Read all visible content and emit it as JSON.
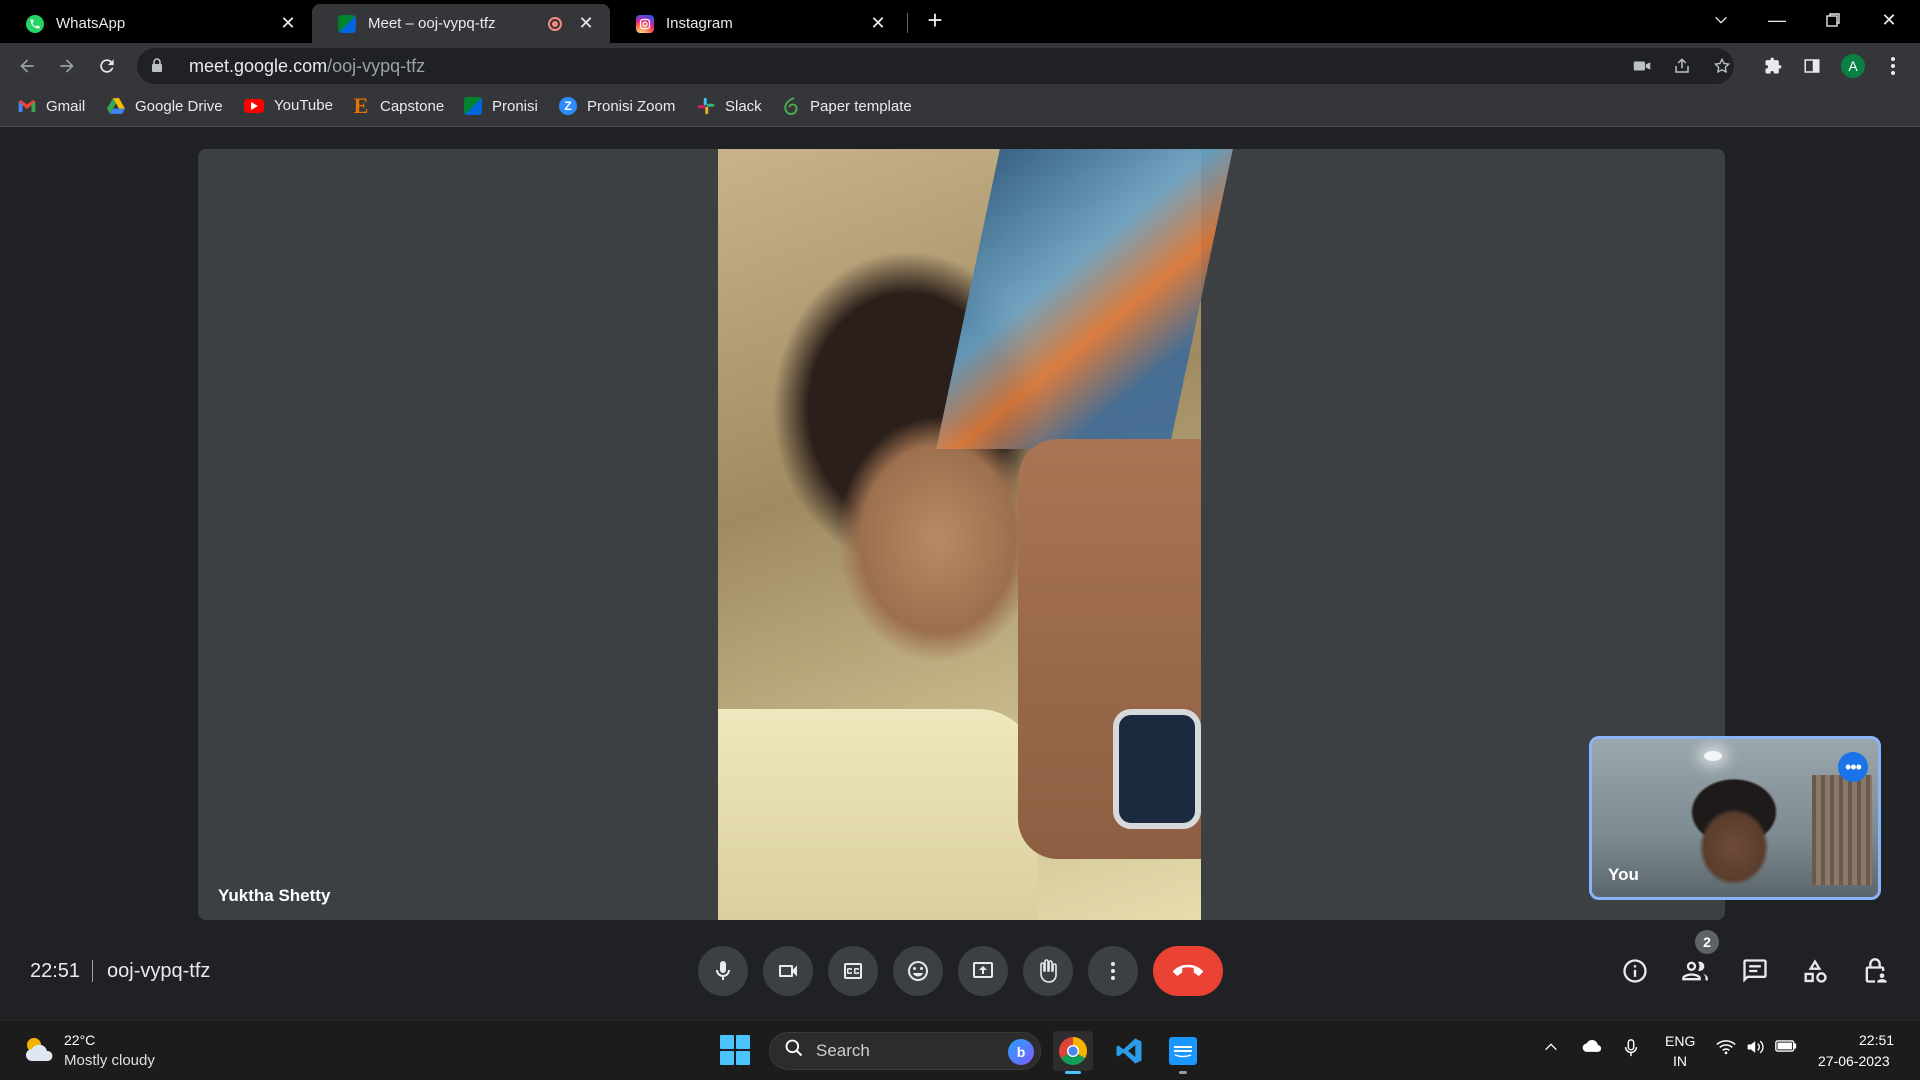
{
  "browser": {
    "tabs": [
      {
        "title": "WhatsApp",
        "icon": "whatsapp-icon"
      },
      {
        "title": "Meet – ooj-vypq-tfz",
        "icon": "google-meet-icon",
        "recording": true
      },
      {
        "title": "Instagram",
        "icon": "instagram-icon"
      }
    ],
    "url_host": "meet.google.com",
    "url_path": "/ooj-vypq-tfz",
    "profile_initial": "A",
    "bookmarks": [
      {
        "label": "Gmail",
        "icon": "gmail-icon"
      },
      {
        "label": "Google Drive",
        "icon": "google-drive-icon"
      },
      {
        "label": "YouTube",
        "icon": "youtube-icon"
      },
      {
        "label": "Capstone",
        "icon": "capstone-icon"
      },
      {
        "label": "Pronisi",
        "icon": "google-meet-icon"
      },
      {
        "label": "Pronisi Zoom",
        "icon": "zoom-icon"
      },
      {
        "label": "Slack",
        "icon": "slack-icon"
      },
      {
        "label": "Paper template",
        "icon": "overleaf-icon"
      }
    ]
  },
  "meet": {
    "main_participant": "Yuktha Shetty",
    "self_label": "You",
    "time": "22:51",
    "meeting_code": "ooj-vypq-tfz",
    "people_count": "2",
    "end_call_color": "#ea4335",
    "controls": [
      "microphone",
      "camera",
      "captions",
      "emoji-reactions",
      "present-screen",
      "raise-hand",
      "more-options",
      "leave-call"
    ],
    "side_actions": [
      "meeting-details",
      "people",
      "chat",
      "activities",
      "host-controls"
    ]
  },
  "taskbar": {
    "weather_temp": "22°C",
    "weather_desc": "Mostly cloudy",
    "search_placeholder": "Search",
    "lang_line1": "ENG",
    "lang_line2": "IN",
    "clock_time": "22:51",
    "clock_date": "27-06-2023",
    "apps": [
      "chrome-icon",
      "vscode-icon",
      "prime-video-icon"
    ]
  }
}
